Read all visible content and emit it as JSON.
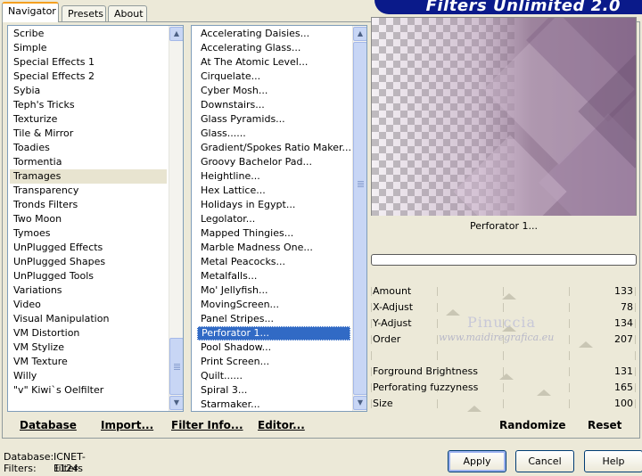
{
  "banner": {
    "title": "Filters Unlimited 2.0"
  },
  "tabs": [
    {
      "label": "Navigator",
      "active": true
    },
    {
      "label": "Presets",
      "active": false
    },
    {
      "label": "About",
      "active": false
    }
  ],
  "categories": {
    "items": [
      "Scribe",
      "Simple",
      "Special Effects 1",
      "Special Effects 2",
      "Sybia",
      "Teph's Tricks",
      "Texturize",
      "Tile & Mirror",
      "Toadies",
      "Tormentia",
      "Tramages",
      "Transparency",
      "Tronds Filters",
      "Two Moon",
      "Tymoes",
      "UnPlugged Effects",
      "UnPlugged Shapes",
      "UnPlugged Tools",
      "Variations",
      "Video",
      "Visual Manipulation",
      "VM Distortion",
      "VM Stylize",
      "VM Texture",
      "Willy",
      "\"v\" Kiwi`s Oelfilter"
    ],
    "highlighted_index": 10
  },
  "filters": {
    "items": [
      "Accelerating Daisies...",
      "Accelerating Glass...",
      "At The Atomic Level...",
      "Cirquelate...",
      "Cyber Mosh...",
      "Downstairs...",
      "Glass Pyramids...",
      "Glass......",
      "Gradient/Spokes Ratio Maker...",
      "Groovy Bachelor Pad...",
      "Heightline...",
      "Hex Lattice...",
      "Holidays in Egypt...",
      "Legolator...",
      "Mapped Thingies...",
      "Marble Madness One...",
      "Metal Peacocks...",
      "Metalfalls...",
      "Mo' Jellyfish...",
      "MovingScreen...",
      "Panel Stripes...",
      "Perforator 1...",
      "Pool Shadow...",
      "Print Screen...",
      "Quilt......",
      "Spiral 3...",
      "Starmaker..."
    ],
    "selected_index": 21
  },
  "preview": {
    "filter_name": "Perforator 1..."
  },
  "params": [
    {
      "label": "Amount",
      "value": "133",
      "fraction": 0.52
    },
    {
      "label": "X-Adjust",
      "value": "78",
      "fraction": 0.31
    },
    {
      "label": "Y-Adjust",
      "value": "134",
      "fraction": 0.52
    },
    {
      "label": "Order",
      "value": "207",
      "fraction": 0.81
    },
    {
      "label": "",
      "value": "",
      "fraction": null
    },
    {
      "label": "Forground Brightness",
      "value": "131",
      "fraction": 0.51
    },
    {
      "label": "Perforating fuzzyness",
      "value": "165",
      "fraction": 0.65
    },
    {
      "label": "Size",
      "value": "100",
      "fraction": 0.39
    }
  ],
  "watermark": {
    "name": "Pinuccia",
    "url": "www.maidiregrafica.eu"
  },
  "links": {
    "database": "Database",
    "import": "Import...",
    "filter_info": "Filter Info...",
    "editor": "Editor...",
    "randomize": "Randomize",
    "reset": "Reset"
  },
  "status": {
    "database_label": "Database:",
    "database_value": "ICNET-Filters",
    "filters_label": "Filters:",
    "filters_value": "1124"
  },
  "buttons": {
    "apply": "Apply",
    "cancel": "Cancel",
    "help": "Help"
  }
}
